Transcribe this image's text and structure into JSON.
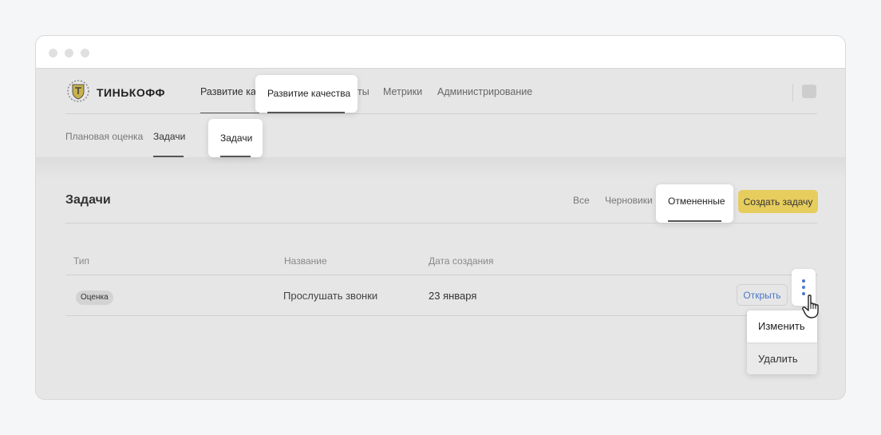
{
  "brand": {
    "name": "ТИНЬКОФФ"
  },
  "nav": {
    "items": [
      "Развитие кач",
      "ты",
      "Метрики",
      "Администрирование"
    ],
    "highlight": "Развитие качества"
  },
  "subnav": {
    "items": [
      "Плановая оценка",
      "Задачи"
    ],
    "highlight": "Задачи"
  },
  "page": {
    "title": "Задачи"
  },
  "filters": {
    "items": [
      "Все",
      "Черновики",
      "Отмененные"
    ],
    "create_label": "Создать задачу"
  },
  "table": {
    "headers": [
      "Тип",
      "Название",
      "Дата создания"
    ],
    "rows": [
      {
        "type": "Оценка",
        "name": "Прослушать звонки",
        "date": "23 января",
        "action": "Открыть"
      }
    ]
  },
  "row_menu": {
    "items": [
      "Изменить",
      "Удалить"
    ]
  },
  "colors": {
    "accent": "#e6cd5e",
    "link": "#4a78c9",
    "dots": "#4a78c9"
  },
  "icons": {
    "logo": "tinkoff-shield-icon",
    "kebab": "more-vertical-icon",
    "cursor": "hand-pointer-icon",
    "avatar": "avatar-icon"
  }
}
